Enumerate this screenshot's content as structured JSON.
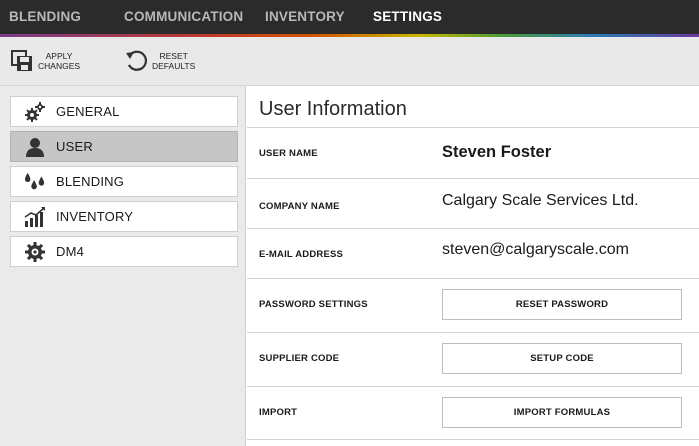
{
  "topnav": {
    "items": [
      {
        "label": "BLENDING"
      },
      {
        "label": "COMMUNICATION"
      },
      {
        "label": "INVENTORY"
      },
      {
        "label": "SETTINGS"
      }
    ],
    "active": "SETTINGS"
  },
  "toolbar": {
    "apply": {
      "line1": "APPLY",
      "line2": "CHANGES",
      "icon": "save-icon"
    },
    "reset": {
      "line1": "RESET",
      "line2": "DEFAULTS",
      "icon": "undo-icon"
    }
  },
  "sidebar": {
    "items": [
      {
        "label": "GENERAL",
        "icon": "gears-icon"
      },
      {
        "label": "USER",
        "icon": "user-icon"
      },
      {
        "label": "BLENDING",
        "icon": "drops-icon"
      },
      {
        "label": "INVENTORY",
        "icon": "bar-chart-icon"
      },
      {
        "label": "DM4",
        "icon": "gear-icon"
      }
    ],
    "active": "USER"
  },
  "main": {
    "title": "User Information",
    "rows": [
      {
        "label": "USER NAME",
        "value": "Steven Foster"
      },
      {
        "label": "COMPANY NAME",
        "value": "Calgary Scale Services Ltd."
      },
      {
        "label": "E-MAIL ADDRESS",
        "value": "steven@calgaryscale.com"
      },
      {
        "label": "PASSWORD SETTINGS",
        "button": "RESET PASSWORD"
      },
      {
        "label": "SUPPLIER CODE",
        "button": "SETUP CODE"
      },
      {
        "label": "IMPORT",
        "button": "IMPORT FORMULAS"
      }
    ]
  },
  "colors": {
    "nav_bg": "#2b2b2b",
    "nav_active": "#ffffff",
    "nav_inactive": "#b8b8b8",
    "sidebar_bg": "#eaeaea",
    "sidebar_active": "#c6c6c6"
  }
}
